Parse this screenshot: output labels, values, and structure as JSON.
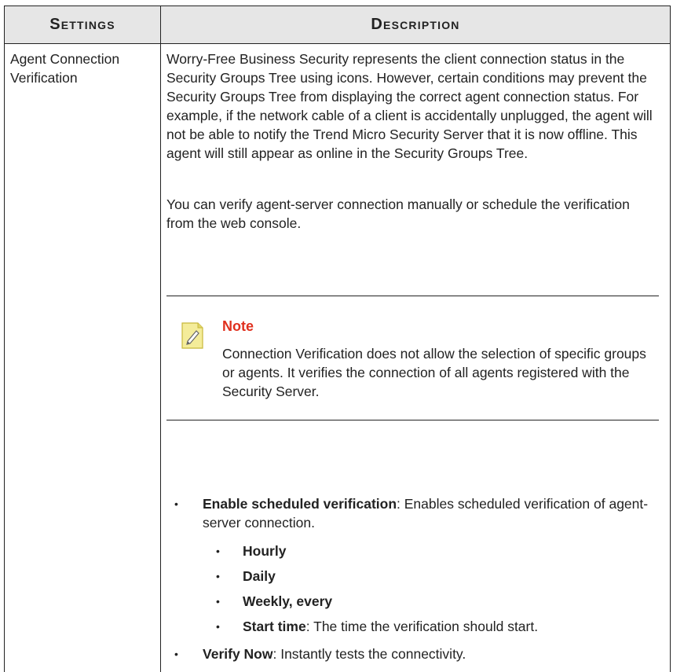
{
  "table": {
    "header_settings": "Settings",
    "header_description": "Description"
  },
  "row": {
    "setting_name": "Agent Connection Verification",
    "paragraph1": "Worry-Free Business Security represents the client connection status in the Security Groups Tree using icons. However, certain conditions may prevent the Security Groups Tree from displaying the correct agent connection status. For example, if the network cable of a client is accidentally unplugged, the agent will not be able to notify the Trend Micro Security Server that it is now offline. This agent will still appear as online in the Security Groups Tree.",
    "paragraph2": "You can verify agent-server connection manually or schedule the verification from the web console.",
    "note": {
      "icon": "note-pencil-icon",
      "title": "Note",
      "text": "Connection Verification does not allow the selection of specific groups or agents. It verifies the connection of all agents registered with the Security Server.",
      "title_color": "#e0301e"
    },
    "bullets": [
      {
        "term": "Enable scheduled verification",
        "text": ": Enables scheduled verification of agent-server connection.",
        "sub": [
          {
            "term": "Hourly",
            "text": ""
          },
          {
            "term": "Daily",
            "text": ""
          },
          {
            "term": "Weekly, every",
            "text": ""
          },
          {
            "term": "Start time",
            "text": ": The time the verification should start."
          }
        ]
      },
      {
        "term": "Verify Now",
        "text": ": Instantly tests the connectivity."
      }
    ],
    "bullet_glyph": "•"
  }
}
